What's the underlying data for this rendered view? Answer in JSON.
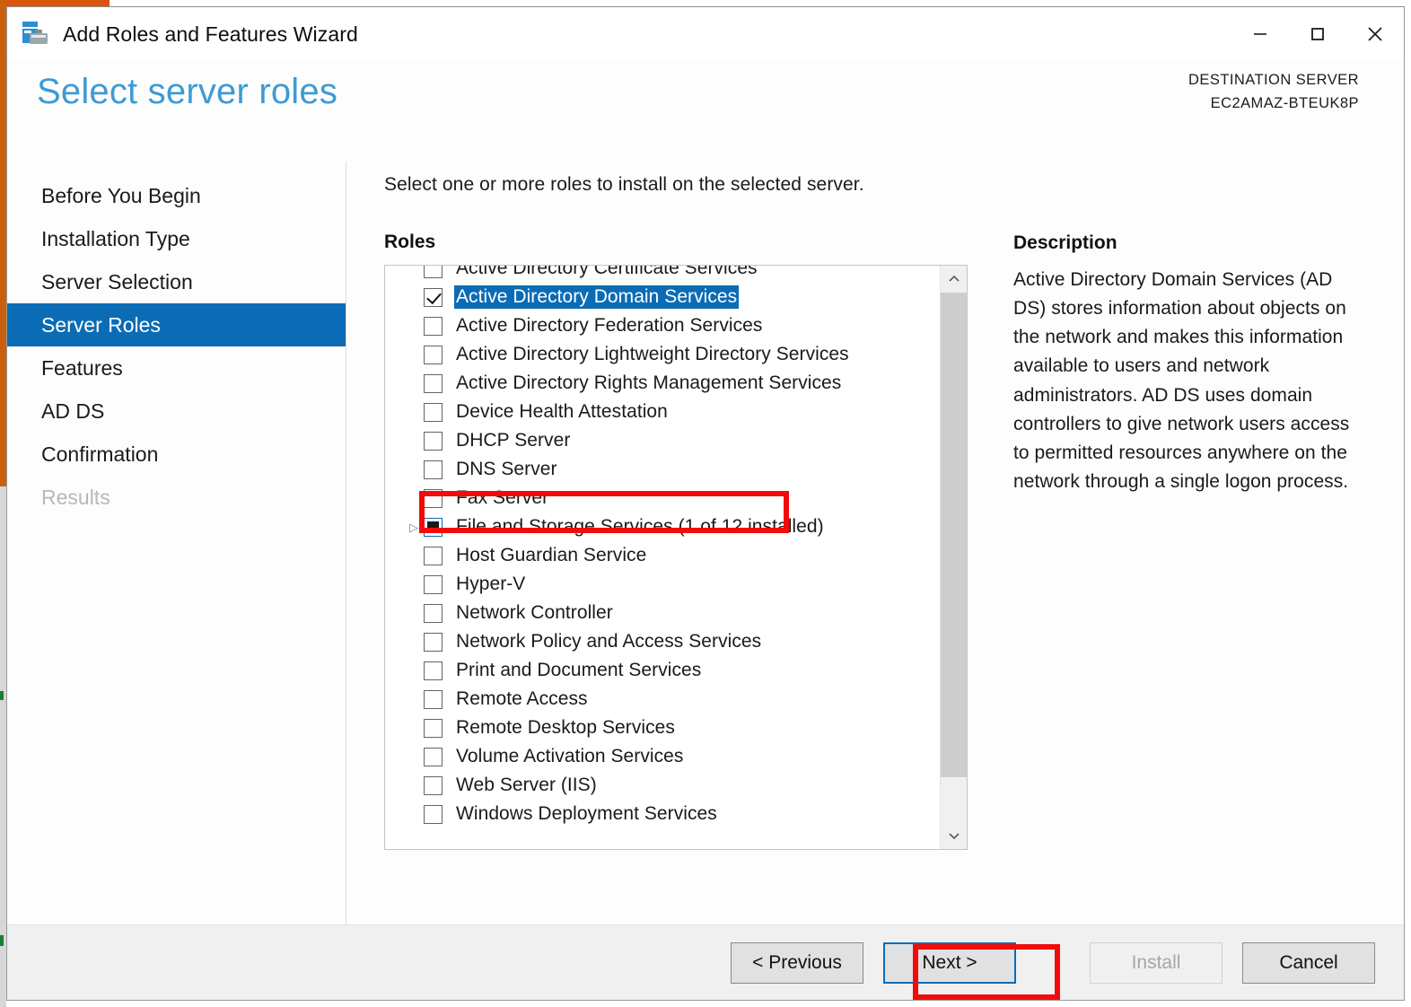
{
  "window": {
    "title": "Add Roles and Features Wizard",
    "app_icon": "server-toolbox-icon",
    "controls": {
      "minimize": "minimize-icon",
      "maximize": "maximize-icon",
      "close": "close-icon"
    }
  },
  "header": {
    "page_title": "Select server roles",
    "destination_label": "DESTINATION SERVER",
    "destination_server": "EC2AMAZ-BTEUK8P"
  },
  "sidebar": {
    "items": [
      {
        "label": "Before You Begin",
        "state": "normal"
      },
      {
        "label": "Installation Type",
        "state": "normal"
      },
      {
        "label": "Server Selection",
        "state": "normal"
      },
      {
        "label": "Server Roles",
        "state": "active"
      },
      {
        "label": "Features",
        "state": "normal"
      },
      {
        "label": "AD DS",
        "state": "normal"
      },
      {
        "label": "Confirmation",
        "state": "normal"
      },
      {
        "label": "Results",
        "state": "disabled"
      }
    ]
  },
  "content": {
    "instruction": "Select one or more roles to install on the selected server.",
    "roles_heading": "Roles",
    "description_heading": "Description",
    "description_body": "Active Directory Domain Services (AD DS) stores information about objects on the network and makes this information available to users and network administrators. AD DS uses domain controllers to give network users access to permitted resources anywhere on the network through a single logon process."
  },
  "roles": [
    {
      "label": "Active Directory Certificate Services",
      "checked": "unchecked",
      "selected": false,
      "expandable": false
    },
    {
      "label": "Active Directory Domain Services",
      "checked": "checked",
      "selected": true,
      "expandable": false
    },
    {
      "label": "Active Directory Federation Services",
      "checked": "unchecked",
      "selected": false,
      "expandable": false
    },
    {
      "label": "Active Directory Lightweight Directory Services",
      "checked": "unchecked",
      "selected": false,
      "expandable": false
    },
    {
      "label": "Active Directory Rights Management Services",
      "checked": "unchecked",
      "selected": false,
      "expandable": false
    },
    {
      "label": "Device Health Attestation",
      "checked": "unchecked",
      "selected": false,
      "expandable": false
    },
    {
      "label": "DHCP Server",
      "checked": "unchecked",
      "selected": false,
      "expandable": false
    },
    {
      "label": "DNS Server",
      "checked": "unchecked",
      "selected": false,
      "expandable": false
    },
    {
      "label": "Fax Server",
      "checked": "unchecked",
      "selected": false,
      "expandable": false
    },
    {
      "label": "File and Storage Services (1 of 12 installed)",
      "checked": "partial",
      "selected": false,
      "expandable": true
    },
    {
      "label": "Host Guardian Service",
      "checked": "unchecked",
      "selected": false,
      "expandable": false
    },
    {
      "label": "Hyper-V",
      "checked": "unchecked",
      "selected": false,
      "expandable": false
    },
    {
      "label": "Network Controller",
      "checked": "unchecked",
      "selected": false,
      "expandable": false
    },
    {
      "label": "Network Policy and Access Services",
      "checked": "unchecked",
      "selected": false,
      "expandable": false
    },
    {
      "label": "Print and Document Services",
      "checked": "unchecked",
      "selected": false,
      "expandable": false
    },
    {
      "label": "Remote Access",
      "checked": "unchecked",
      "selected": false,
      "expandable": false
    },
    {
      "label": "Remote Desktop Services",
      "checked": "unchecked",
      "selected": false,
      "expandable": false
    },
    {
      "label": "Volume Activation Services",
      "checked": "unchecked",
      "selected": false,
      "expandable": false
    },
    {
      "label": "Web Server (IIS)",
      "checked": "unchecked",
      "selected": false,
      "expandable": false
    },
    {
      "label": "Windows Deployment Services",
      "checked": "unchecked",
      "selected": false,
      "expandable": false
    }
  ],
  "scrollbar": {
    "up_arrow": "chevron-up-icon",
    "down_arrow": "chevron-down-icon"
  },
  "footer": {
    "previous": "< Previous",
    "next": "Next >",
    "install": "Install",
    "cancel": "Cancel"
  },
  "colors": {
    "accent_blue": "#0b6cb5",
    "title_blue": "#3d9bd4",
    "annotation_red": "#f20b0b",
    "footer_grey": "#f0f0f0"
  }
}
